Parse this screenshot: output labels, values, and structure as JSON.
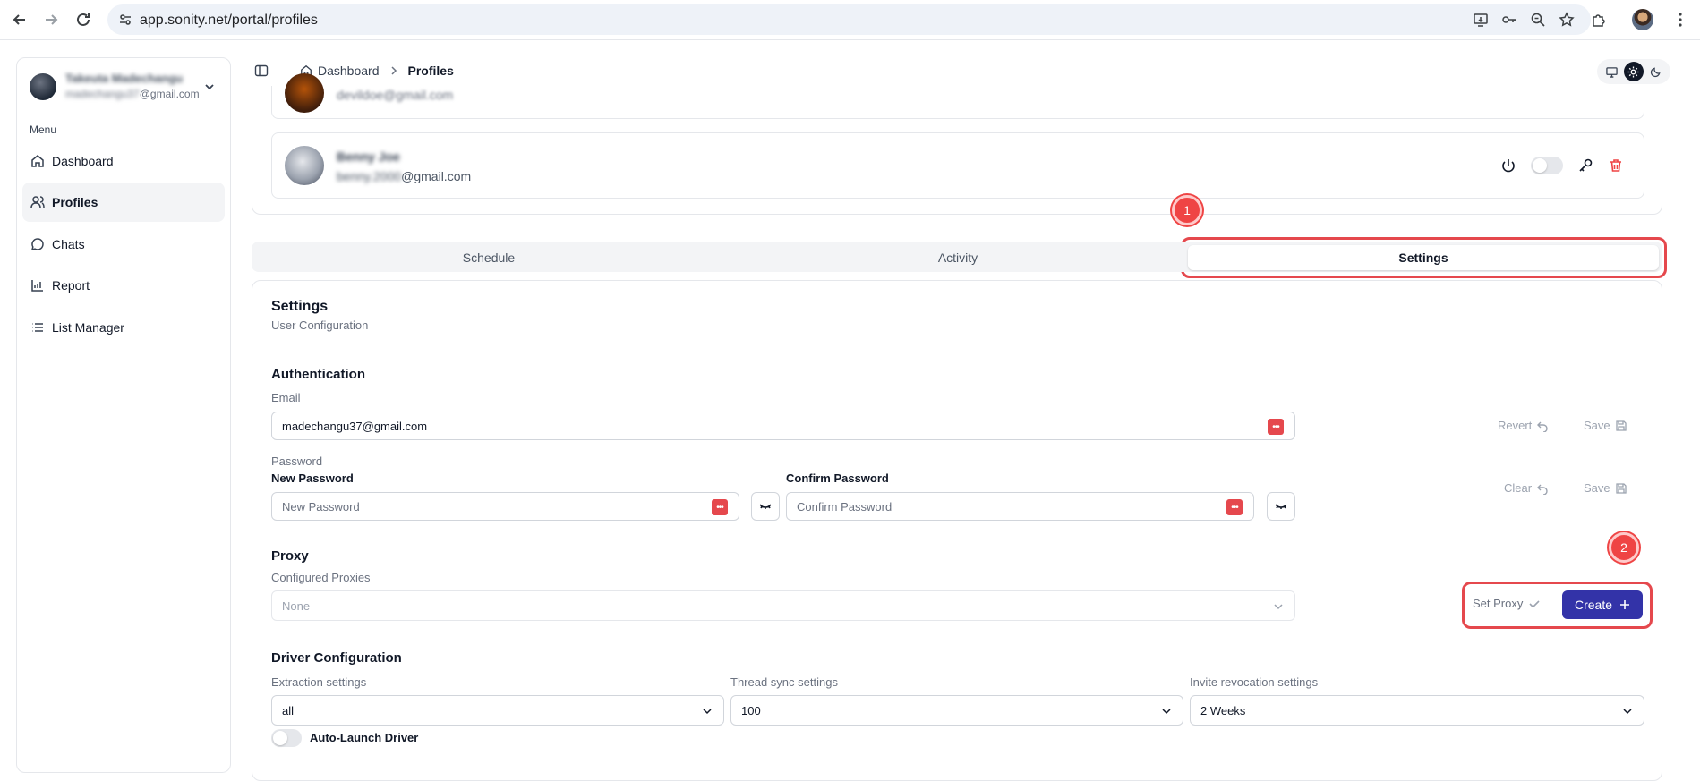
{
  "browser": {
    "url": "app.sonity.net/portal/profiles"
  },
  "account": {
    "name": "Takeuta Madechangu",
    "email_hidden": "madechangu37",
    "email_domain": "@gmail.com"
  },
  "sidebar": {
    "menu_label": "Menu",
    "items": [
      {
        "label": "Dashboard",
        "icon": "home-icon"
      },
      {
        "label": "Profiles",
        "icon": "users-icon"
      },
      {
        "label": "Chats",
        "icon": "chat-icon"
      },
      {
        "label": "Report",
        "icon": "chart-icon"
      },
      {
        "label": "List Manager",
        "icon": "list-icon"
      }
    ]
  },
  "breadcrumb": {
    "root": "Dashboard",
    "current": "Profiles"
  },
  "profiles": {
    "top_email": "devildoe@gmail.com",
    "main_name": "Benny Joe",
    "main_email_hidden": "benny.2000",
    "main_email_domain": "@gmail.com"
  },
  "markers": {
    "one": "1",
    "two": "2"
  },
  "tabs": [
    {
      "label": "Schedule"
    },
    {
      "label": "Activity"
    },
    {
      "label": "Settings"
    }
  ],
  "settings": {
    "title": "Settings",
    "subtitle": "User Configuration",
    "auth": {
      "title": "Authentication",
      "email_label": "Email",
      "email_value": "madechangu37@gmail.com",
      "revert": "Revert",
      "save": "Save",
      "password_label": "Password",
      "new_password_label": "New Password",
      "new_password_placeholder": "New Password",
      "confirm_password_label": "Confirm Password",
      "confirm_password_placeholder": "Confirm Password",
      "clear": "Clear",
      "save2": "Save"
    },
    "proxy": {
      "title": "Proxy",
      "configured_label": "Configured Proxies",
      "selected": "None",
      "set_proxy": "Set Proxy",
      "create": "Create"
    },
    "driver": {
      "title": "Driver Configuration",
      "extraction_label": "Extraction settings",
      "extraction_value": "all",
      "thread_label": "Thread sync settings",
      "thread_value": "100",
      "invite_label": "Invite revocation settings",
      "invite_value": "2 Weeks",
      "auto_launch": "Auto-Launch Driver"
    }
  },
  "colors": {
    "accent": "#3333a8",
    "annotation": "#e5484d",
    "danger": "#ef4444"
  }
}
